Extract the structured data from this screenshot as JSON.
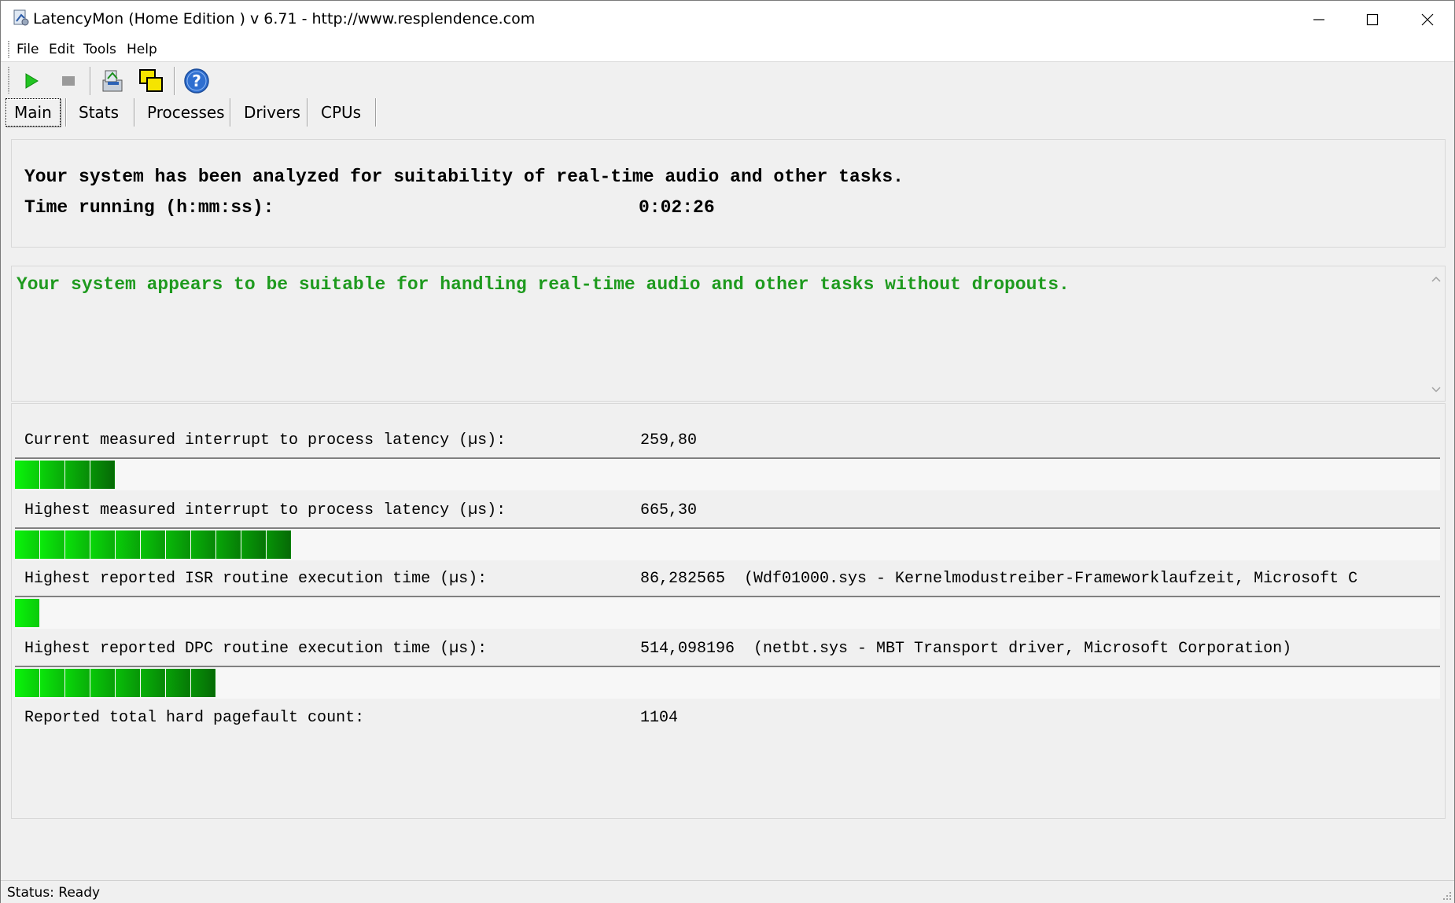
{
  "window": {
    "title": "LatencyMon  (Home Edition )  v 6.71 - http://www.resplendence.com"
  },
  "menu": {
    "file": "File",
    "edit": "Edit",
    "tools": "Tools",
    "help": "Help"
  },
  "toolbar": {
    "icons": [
      "play-icon",
      "stop-icon",
      "analyze-icon",
      "windows-icon",
      "help-icon"
    ]
  },
  "tabs": [
    {
      "label": "Main",
      "active": true
    },
    {
      "label": "Stats",
      "active": false
    },
    {
      "label": "Processes",
      "active": false
    },
    {
      "label": "Drivers",
      "active": false
    },
    {
      "label": "CPUs",
      "active": false
    }
  ],
  "summary": {
    "line1": "Your system has been analyzed for suitability of real-time audio and other tasks.",
    "time_label": "Time running (h:mm:ss):",
    "time_value": "0:02:26"
  },
  "verdict": {
    "text": "Your system appears to be suitable for handling real-time audio and other tasks without dropouts.",
    "color": "#1e9a1e"
  },
  "metrics": [
    {
      "label": "Current measured interrupt to process latency (µs):",
      "value": "259,80",
      "segments": 4
    },
    {
      "label": "Highest measured interrupt to process latency (µs):",
      "value": "665,30",
      "segments": 11
    },
    {
      "label": "Highest reported ISR routine execution time (µs):",
      "value": "86,282565  (Wdf01000.sys - Kernelmodustreiber-Frameworklaufzeit, Microsoft C",
      "segments": 1
    },
    {
      "label": "Highest reported DPC routine execution time (µs):",
      "value": "514,098196  (netbt.sys - MBT Transport driver, Microsoft Corporation)",
      "segments": 8
    },
    {
      "label": "Reported total hard pagefault count:",
      "value": "1104",
      "segments": 0
    }
  ],
  "status": {
    "text": "Status: Ready"
  }
}
